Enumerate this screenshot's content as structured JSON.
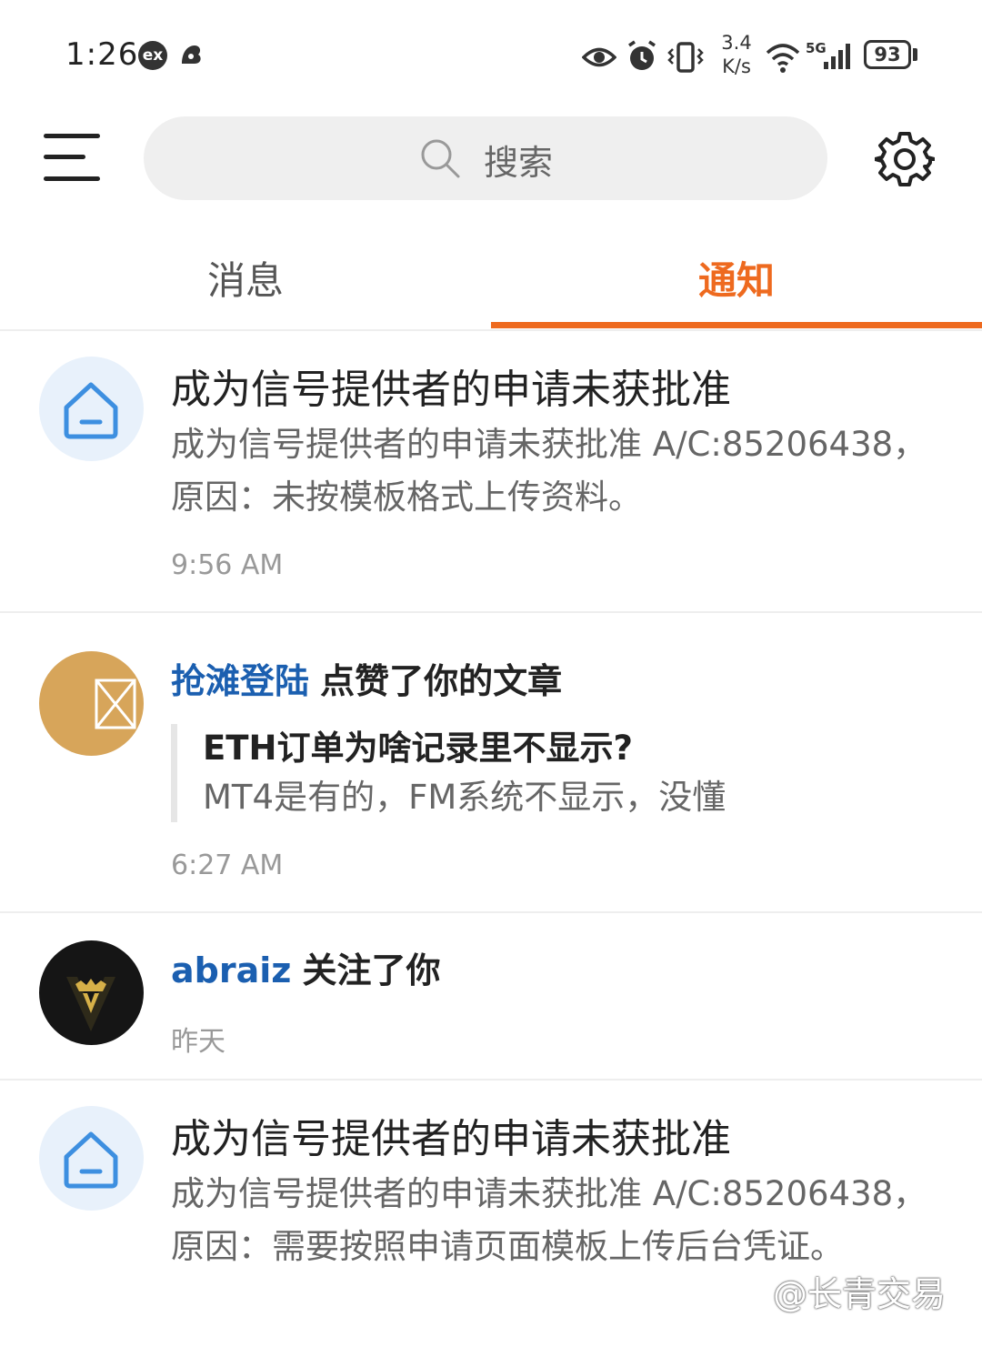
{
  "status_bar": {
    "time": "1:26",
    "ex_badge": "ex",
    "speed_value": "3.4",
    "speed_unit": "K/s",
    "network": "5G",
    "battery": "93"
  },
  "search": {
    "placeholder": "搜索"
  },
  "tabs": [
    {
      "label": "消息",
      "active": false
    },
    {
      "label": "通知",
      "active": true
    }
  ],
  "colors": {
    "accent": "#ee6a1f",
    "link": "#1b5fb0"
  },
  "notifications": [
    {
      "icon": "home-icon",
      "title": "成为信号提供者的申请未获批准",
      "body": "成为信号提供者的申请未获批准 A/C:85206438，原因：未按模板格式上传资料。",
      "time": "9:56 AM"
    },
    {
      "actor": "抢滩登陆",
      "action": "点赞了你的文章",
      "quote_title": "ETH订单为啥记录里不显示?",
      "quote_body": "MT4是有的，FM系统不显示，没懂",
      "time": "6:27 AM"
    },
    {
      "actor": "abraiz",
      "action": "关注了你",
      "time": "昨天"
    },
    {
      "icon": "home-icon",
      "title": "成为信号提供者的申请未获批准",
      "body": "成为信号提供者的申请未获批准 A/C:85206438，原因：需要按照申请页面模板上传后台凭证。"
    }
  ],
  "watermark": "@长青交易"
}
